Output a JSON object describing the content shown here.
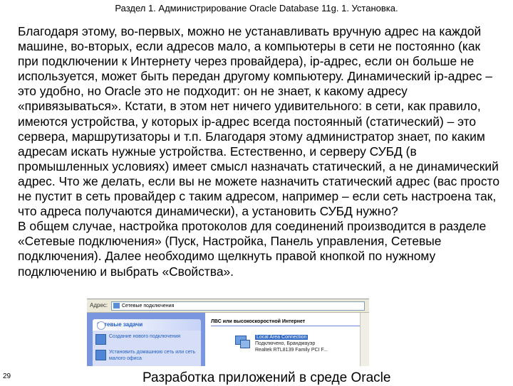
{
  "header": "Раздел 1. Администрирование Oracle Database 11g. 1. Установка.",
  "body": {
    "paragraph1": "Благодаря этому, во-первых, можно не устанавливать вручную адрес на каждой машине, во-вторых, если адресов мало, а компьютеры в сети не постоянно (как при подключении к Интернету через провайдера), ip-адрес, если он больше не используется, может быть передан другому компьютеру. Динамический ip-адрес – это удобно, но Oracle это не подходит: он не знает, к какому адресу «привязываться». Кстати, в этом нет ничего удивительного: в сети, как правило, имеются устройства, у которых ip-адрес всегда постоянный (статический) – это сервера, маршрутизаторы и т.п. Благодаря этому администратор знает, по каким адресам искать нужные устройства. Естественно, и серверу СУБД (в промышленных условиях) имеет смысл назначать статический, а не динамический адрес. Что же делать, если вы не можете назначить статический адрес (вас просто не пустит в сеть провайдер с таким адресом, например – если сеть настроена так, что адреса получаются динамически), а установить СУБД нужно?",
    "paragraph2": "В общем случае, настройка протоколов для соединений производится в разделе «Сетевые подключения» (Пуск, Настройка, Панель управления, Сетевые подключения). Далее необходимо щелкнуть правой кнопкой по нужному подключению и выбрать «Свойства»."
  },
  "screenshot": {
    "address_label": "Адрес:",
    "address_value": "Сетевые подключения",
    "task_pane_title": "Сетевые задачи",
    "task_items": [
      "Создание нового подключения",
      "Установить домашнюю сеть или сеть малого офиса"
    ],
    "section_title": "ЛВС или высокоскоростной Интернет",
    "connection": {
      "name": "Local Area Connection",
      "status": "Подключено, Брандмауэр",
      "device": "Realtek RTL8139 Family PCI F..."
    }
  },
  "page_number": "29",
  "footer": "Разработка приложений в среде Oracle"
}
